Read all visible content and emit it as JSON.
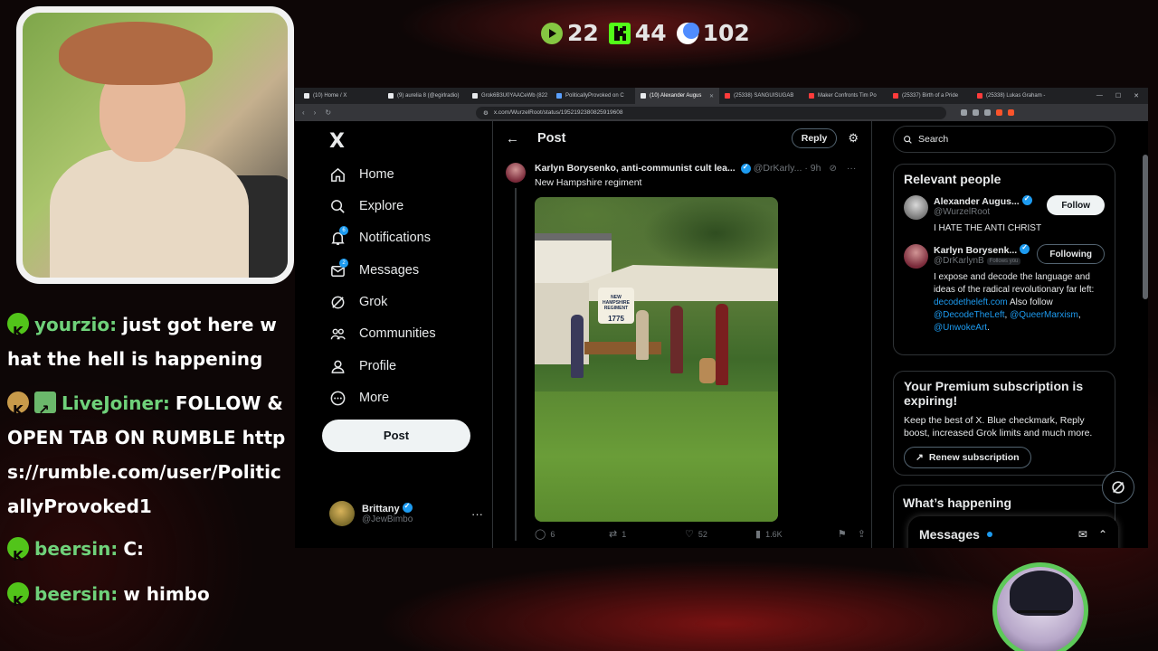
{
  "overlay": {
    "stats": [
      {
        "icon": "rumble-icon",
        "value": "22",
        "color": "#85c742"
      },
      {
        "icon": "kick-icon",
        "value": "44",
        "color": "#53fc18"
      },
      {
        "icon": "moon-icon",
        "value": "102",
        "color": "#4f8cff"
      }
    ]
  },
  "chat": [
    {
      "badge": "kick",
      "user": "yourzio:",
      "text": "just got here what the hell is happening"
    },
    {
      "badge": "cookie-pencil",
      "user": "LiveJoiner:",
      "text": "FOLLOW & OPEN TAB ON RUMBLE https://rumble.com/user/PoliticallyProvoked1"
    },
    {
      "badge": "kick",
      "user": "beersin:",
      "text": "C:"
    },
    {
      "badge": "kick",
      "user": "beersin:",
      "text": "w himbo"
    }
  ],
  "browser": {
    "tabs": [
      {
        "title": "(10) Home / X",
        "fav": "x"
      },
      {
        "title": "(9) aurelia 8 (@egirlradio)",
        "fav": "x"
      },
      {
        "title": "Grok6B3U0YAACeWb (822",
        "fav": "x"
      },
      {
        "title": "PoliticallyProvoked on C",
        "fav": "blue"
      },
      {
        "title": "(10) Alexander Augus",
        "fav": "x",
        "active": true
      },
      {
        "title": "(25338) SANGUISUGAB",
        "fav": "red"
      },
      {
        "title": "Maker Confronts Tim Po",
        "fav": "red"
      },
      {
        "title": "(25337) Birth of a Pride",
        "fav": "red"
      },
      {
        "title": "(25338) Lukas Graham -",
        "fav": "red"
      }
    ],
    "url": "x.com/WurzelRoot/status/1952192380825919608"
  },
  "nav": {
    "logo": "X",
    "items": [
      {
        "label": "Home",
        "icon": "home-icon"
      },
      {
        "label": "Explore",
        "icon": "search-icon"
      },
      {
        "label": "Notifications",
        "icon": "bell-icon",
        "badge": "6"
      },
      {
        "label": "Messages",
        "icon": "mail-icon",
        "badge": "2"
      },
      {
        "label": "Grok",
        "icon": "grok-icon"
      },
      {
        "label": "Communities",
        "icon": "communities-icon"
      },
      {
        "label": "Profile",
        "icon": "profile-icon"
      },
      {
        "label": "More",
        "icon": "more-circle-icon"
      }
    ],
    "post_label": "Post",
    "account": {
      "name": "Brittany",
      "handle": "@JewBimbo"
    }
  },
  "post": {
    "header_title": "Post",
    "reply_label": "Reply",
    "author_name": "Karlyn Borysenko, anti-communist cult lea...",
    "author_handle": "@DrKarly...",
    "time": "· 9h",
    "text": "New Hampshire regiment",
    "media_sign_top": "NEW HAMPSHIRE REGIMENT",
    "media_sign_year": "1775",
    "stats": {
      "replies": "6",
      "reposts": "1",
      "likes": "52",
      "views": "1.6K"
    }
  },
  "sidebar": {
    "search_placeholder": "Search",
    "relevant_title": "Relevant people",
    "people": [
      {
        "name": "Alexander Augus...",
        "handle": "@WurzelRoot",
        "button": "Follow",
        "bio": "I HATE THE ANTI CHRIST"
      },
      {
        "name": "Karlyn Borysenk...",
        "handle": "@DrKarlynB",
        "follows_you": "Follows you",
        "button": "Following",
        "bio": "I expose and decode the language and ideas of the radical revolutionary far left:",
        "link1": "decodetheleft.com",
        "bio2": "Also follow",
        "link2": "@DecodeTheLeft",
        "link3": "@QueerMarxism",
        "link4": "@UnwokeArt"
      }
    ],
    "premium_title": "Your Premium subscription is expiring!",
    "premium_text": "Keep the best of X. Blue checkmark, Reply boost, increased Grok limits and much more.",
    "renew_label": "Renew subscription",
    "happening_title": "What’s happening",
    "messages_title": "Messages"
  }
}
